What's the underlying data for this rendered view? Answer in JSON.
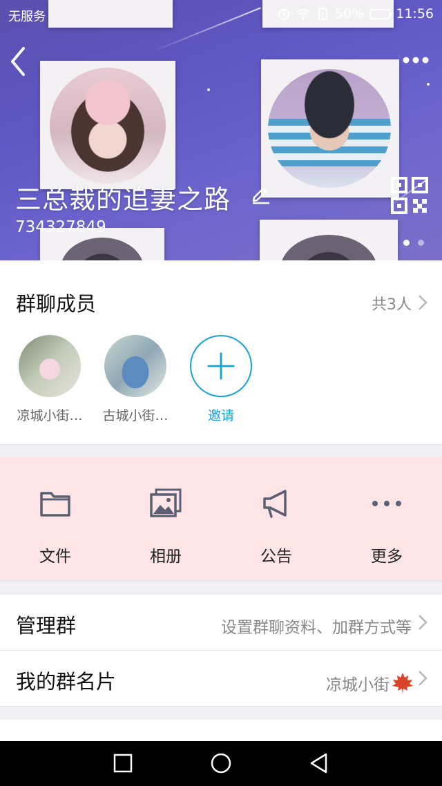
{
  "status_bar": {
    "carrier": "无服务",
    "battery": "50%",
    "time": "11:56"
  },
  "header": {
    "group_name": "三总裁的追妻之路",
    "group_id": "734327849"
  },
  "members": {
    "title": "群聊成员",
    "count": "共3人",
    "list": [
      {
        "name": "凉城小街…"
      },
      {
        "name": "古城小街…"
      }
    ],
    "invite_label": "邀请"
  },
  "tools": [
    {
      "label": "文件",
      "icon": "folder-icon"
    },
    {
      "label": "相册",
      "icon": "album-icon"
    },
    {
      "label": "公告",
      "icon": "megaphone-icon"
    },
    {
      "label": "更多",
      "icon": "more-icon"
    }
  ],
  "settings": {
    "manage_label": "管理群",
    "manage_value": "设置群聊资料、加群方式等",
    "card_label": "我的群名片",
    "card_value": "凉城小街"
  },
  "colors": {
    "accent": "#1aa0d8",
    "tools_bg": "#fde4e7",
    "hero": "#5f58c4"
  }
}
